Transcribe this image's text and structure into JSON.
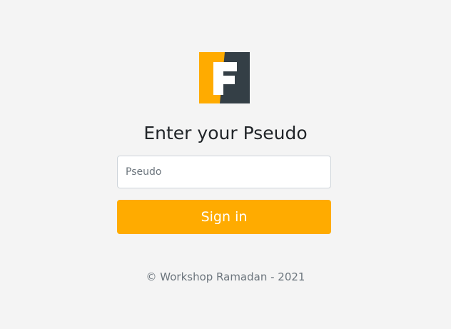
{
  "logo": {
    "icon": "f-logo-icon",
    "colors": {
      "left": "#ffab00",
      "right": "#343f46",
      "letter": "#ffffff"
    }
  },
  "login": {
    "title": "Enter your Pseudo",
    "pseudo_placeholder": "Pseudo",
    "pseudo_value": "",
    "signin_label": "Sign in",
    "accent_color": "#ffab00"
  },
  "footer": {
    "text": "© Workshop Ramadan - 2021"
  }
}
